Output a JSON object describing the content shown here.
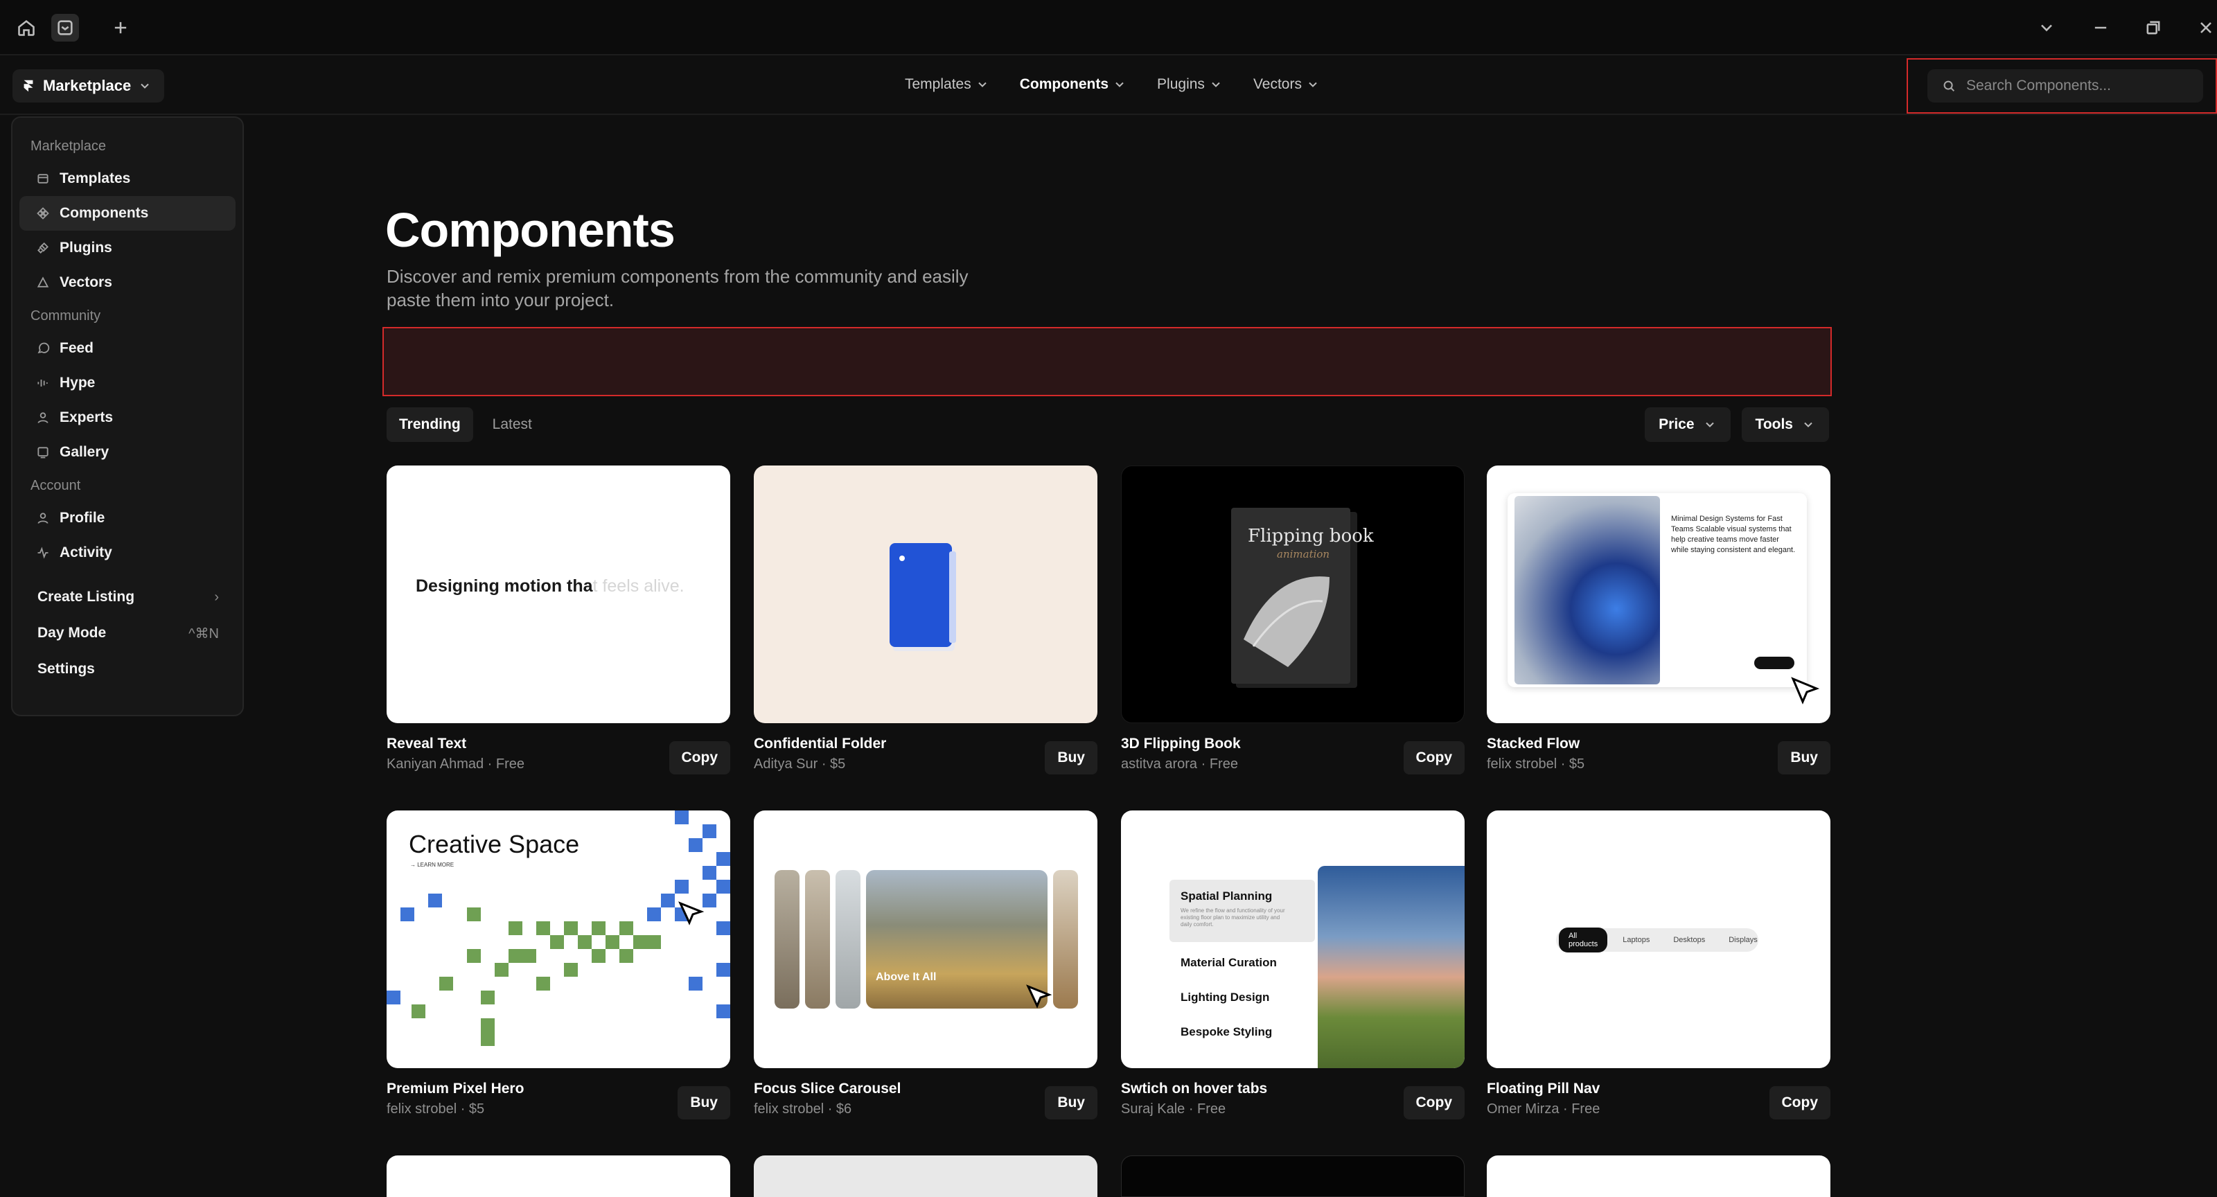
{
  "market": {
    "label": "Marketplace"
  },
  "nav": {
    "items": [
      "Templates",
      "Components",
      "Plugins",
      "Vectors"
    ]
  },
  "search": {
    "placeholder": "Search Components..."
  },
  "dropdown": {
    "sec_marketplace": "Marketplace",
    "sec_community": "Community",
    "sec_account": "Account",
    "templates": "Templates",
    "components": "Components",
    "plugins": "Plugins",
    "vectors": "Vectors",
    "feed": "Feed",
    "hype": "Hype",
    "experts": "Experts",
    "gallery": "Gallery",
    "profile": "Profile",
    "activity": "Activity",
    "create_listing": "Create Listing",
    "day_mode": "Day Mode",
    "day_mode_shortcut": "^⌘N",
    "settings": "Settings"
  },
  "page": {
    "title": "Components",
    "subtitle": "Discover and remix premium components from the community and easily paste them into your project."
  },
  "tabs": {
    "trending": "Trending",
    "latest": "Latest"
  },
  "filters": {
    "price": "Price",
    "tools": "Tools"
  },
  "thumbs": {
    "reveal_dark": "Designing motion tha",
    "reveal_light": "t feels alive.",
    "book_title": "Flipping book",
    "book_script": "animation",
    "stack_text": "Minimal Design Systems for Fast Teams Scalable visual systems that help creative teams move faster while staying consistent and elegant.",
    "pixel_title": "Creative Space",
    "pixel_link": "→ LEARN MORE",
    "carousel_title": "Above It All",
    "tabs_title": "Spatial Planning",
    "tabs_desc": "We refine the flow and functionality of your existing floor plan to maximize utility and daily comfort.",
    "tabs_1": "Material Curation",
    "tabs_2": "Lighting Design",
    "tabs_3": "Bespoke Styling",
    "pill_1": "All products",
    "pill_2": "Laptops",
    "pill_3": "Desktops",
    "pill_4": "Displays"
  },
  "cards": [
    {
      "title": "Reveal Text",
      "author": "Kaniyan Ahmad · Free",
      "action": "Copy"
    },
    {
      "title": "Confidential Folder",
      "author": "Aditya Sur · $5",
      "action": "Buy"
    },
    {
      "title": "3D Flipping Book",
      "author": "astitva arora · Free",
      "action": "Copy"
    },
    {
      "title": "Stacked Flow",
      "author": "felix strobel · $5",
      "action": "Buy"
    },
    {
      "title": "Premium Pixel Hero",
      "author": "felix strobel · $5",
      "action": "Buy"
    },
    {
      "title": "Focus Slice Carousel",
      "author": "felix strobel · $6",
      "action": "Buy"
    },
    {
      "title": "Swtich on hover tabs",
      "author": "Suraj Kale · Free",
      "action": "Copy"
    },
    {
      "title": "Floating Pill Nav",
      "author": "Omer Mirza · Free",
      "action": "Copy"
    }
  ]
}
